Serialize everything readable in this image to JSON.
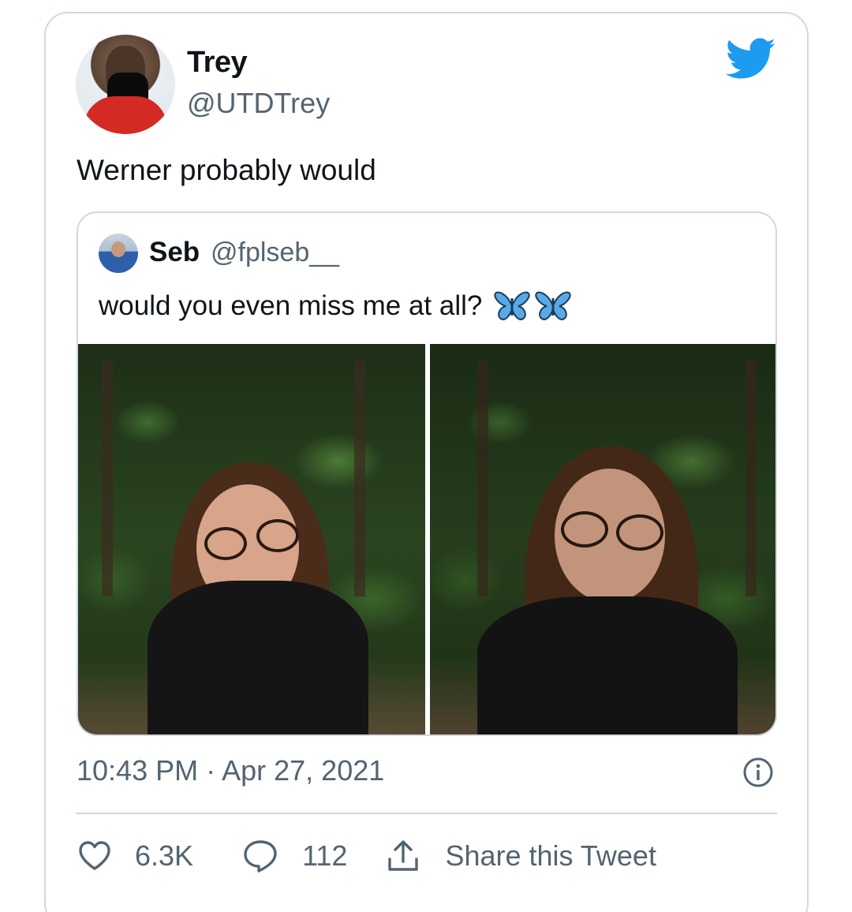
{
  "author": {
    "display_name": "Trey",
    "handle": "@UTDTrey"
  },
  "tweet": {
    "text": "Werner probably would",
    "timestamp": "10:43 PM · Apr 27, 2021"
  },
  "quoted_tweet": {
    "display_name": "Seb",
    "handle": "@fplseb__",
    "text": "would you even miss me at all?",
    "emoji": [
      "butterfly-icon",
      "butterfly-icon"
    ],
    "photos": [
      "photo-1",
      "photo-2"
    ]
  },
  "actions": {
    "likes": "6.3K",
    "replies": "112",
    "share_label": "Share this Tweet"
  },
  "colors": {
    "accent": "#1d9bf0",
    "secondary_text": "#536471",
    "border": "#cfd9de"
  }
}
